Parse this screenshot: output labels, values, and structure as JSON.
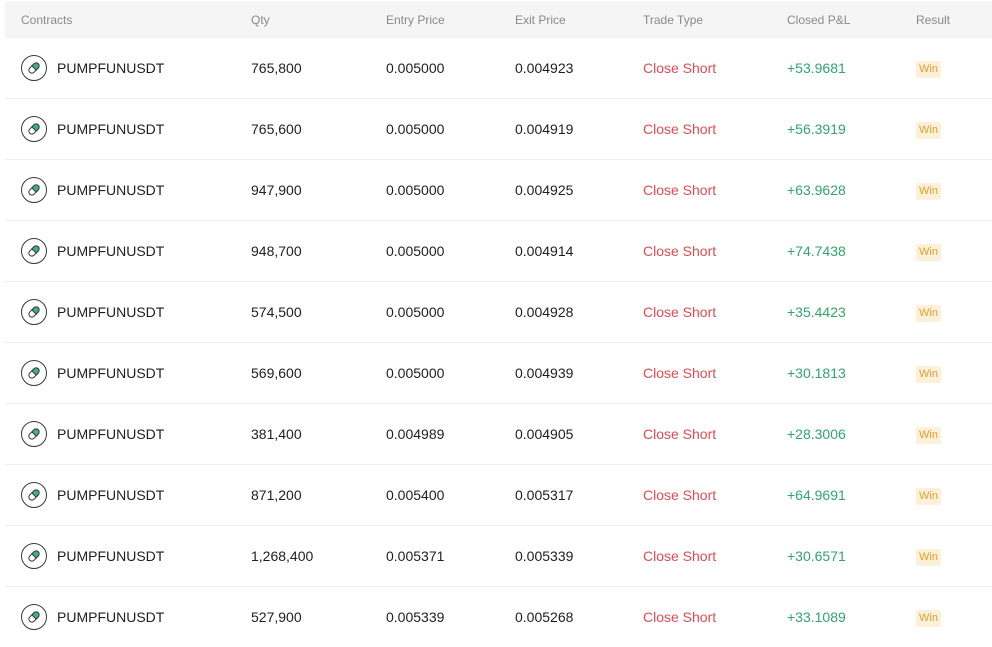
{
  "headers": {
    "contracts": "Contracts",
    "qty": "Qty",
    "entry_price": "Entry Price",
    "exit_price": "Exit Price",
    "trade_type": "Trade Type",
    "closed_pnl": "Closed P&L",
    "result": "Result"
  },
  "icon": "pill-coin-icon",
  "colors": {
    "trade_type": "#e04b52",
    "pnl": "#2fa66a",
    "badge_bg": "#fdf0d8",
    "badge_text": "#e0a030"
  },
  "rows": [
    {
      "contract": "PUMPFUNUSDT",
      "qty": "765,800",
      "entry": "0.005000",
      "exit": "0.004923",
      "type": "Close Short",
      "pnl": "+53.9681",
      "result": "Win"
    },
    {
      "contract": "PUMPFUNUSDT",
      "qty": "765,600",
      "entry": "0.005000",
      "exit": "0.004919",
      "type": "Close Short",
      "pnl": "+56.3919",
      "result": "Win"
    },
    {
      "contract": "PUMPFUNUSDT",
      "qty": "947,900",
      "entry": "0.005000",
      "exit": "0.004925",
      "type": "Close Short",
      "pnl": "+63.9628",
      "result": "Win"
    },
    {
      "contract": "PUMPFUNUSDT",
      "qty": "948,700",
      "entry": "0.005000",
      "exit": "0.004914",
      "type": "Close Short",
      "pnl": "+74.7438",
      "result": "Win"
    },
    {
      "contract": "PUMPFUNUSDT",
      "qty": "574,500",
      "entry": "0.005000",
      "exit": "0.004928",
      "type": "Close Short",
      "pnl": "+35.4423",
      "result": "Win"
    },
    {
      "contract": "PUMPFUNUSDT",
      "qty": "569,600",
      "entry": "0.005000",
      "exit": "0.004939",
      "type": "Close Short",
      "pnl": "+30.1813",
      "result": "Win"
    },
    {
      "contract": "PUMPFUNUSDT",
      "qty": "381,400",
      "entry": "0.004989",
      "exit": "0.004905",
      "type": "Close Short",
      "pnl": "+28.3006",
      "result": "Win"
    },
    {
      "contract": "PUMPFUNUSDT",
      "qty": "871,200",
      "entry": "0.005400",
      "exit": "0.005317",
      "type": "Close Short",
      "pnl": "+64.9691",
      "result": "Win"
    },
    {
      "contract": "PUMPFUNUSDT",
      "qty": "1,268,400",
      "entry": "0.005371",
      "exit": "0.005339",
      "type": "Close Short",
      "pnl": "+30.6571",
      "result": "Win"
    },
    {
      "contract": "PUMPFUNUSDT",
      "qty": "527,900",
      "entry": "0.005339",
      "exit": "0.005268",
      "type": "Close Short",
      "pnl": "+33.1089",
      "result": "Win"
    }
  ]
}
